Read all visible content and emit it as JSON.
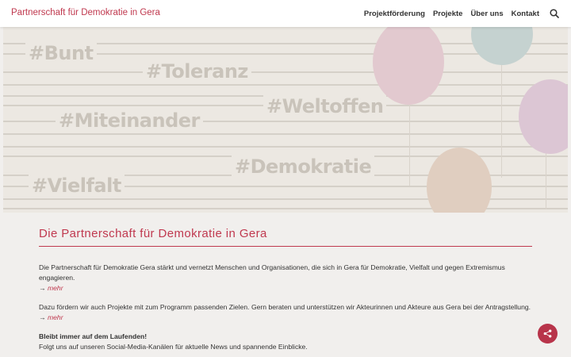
{
  "header": {
    "brand": "Partnerschaft für Demokratie in Gera",
    "nav": [
      "Projektförderung",
      "Projekte",
      "Über uns",
      "Kontakt"
    ],
    "search_icon": "search-icon"
  },
  "hero": {
    "hashtags": [
      "#Bunt",
      "#Toleranz",
      "#Weltoffen",
      "#Miteinander",
      "#Demokratie",
      "#Vielfalt"
    ]
  },
  "main": {
    "title": "Die Partnerschaft für Demokratie in Gera",
    "p1": "Die Partnerschaft für Demokratie Gera stärkt und vernetzt Menschen und Organisationen, die sich in Gera für Demokratie, Vielfalt und gegen Extremismus engagieren.",
    "p2": "Dazu fördern wir auch Projekte mit zum Programm passenden Zielen. Gern beraten und unterstützen wir Akteurinnen und Akteure aus Gera bei der Antragstellung.",
    "arrow": "→",
    "more": "mehr",
    "p3_strong": "Bleibt immer auf dem Laufenden!",
    "p3": "Folgt uns auf unseren Social-Media-Kanälen für aktuelle News und spannende Einblicke."
  },
  "share": {
    "icon": "share-icon"
  },
  "colors": {
    "accent": "#c0394f",
    "background": "#f1efed",
    "header": "#ffffff"
  }
}
